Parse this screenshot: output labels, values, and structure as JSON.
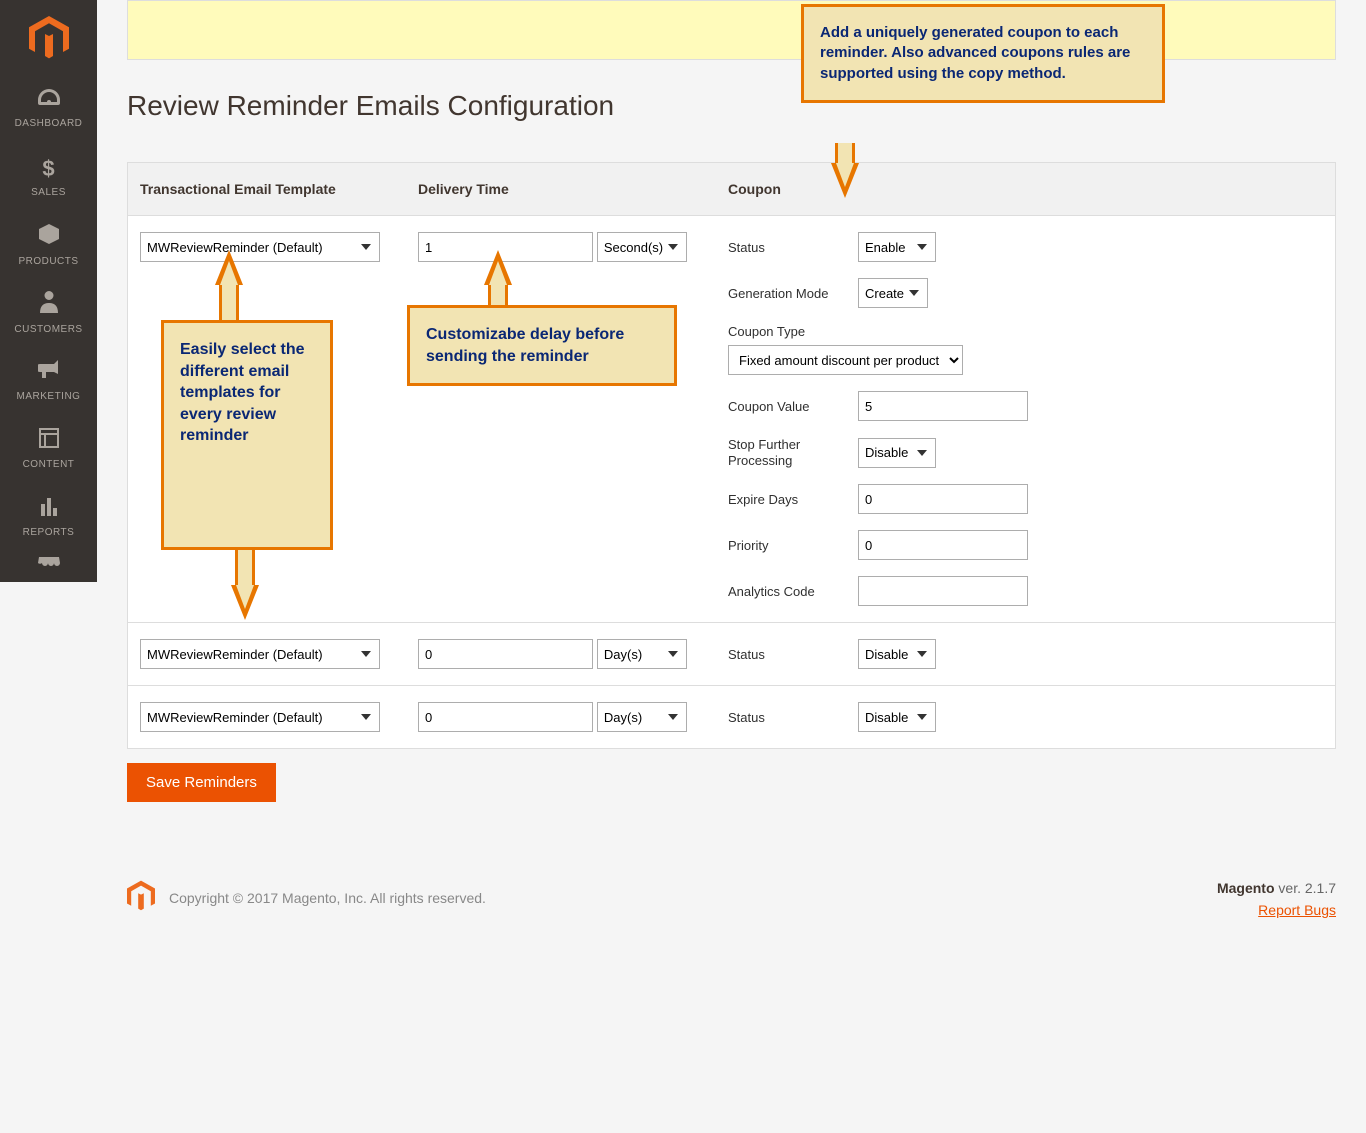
{
  "sidebar": {
    "items": [
      {
        "label": "DASHBOARD",
        "glyph": "◔"
      },
      {
        "label": "SALES",
        "glyph": "$"
      },
      {
        "label": "PRODUCTS",
        "glyph": "⬢"
      },
      {
        "label": "CUSTOMERS",
        "glyph": "👤"
      },
      {
        "label": "MARKETING",
        "glyph": "📣"
      },
      {
        "label": "CONTENT",
        "glyph": "▣"
      },
      {
        "label": "REPORTS",
        "glyph": "📊"
      }
    ]
  },
  "page": {
    "title": "Review Reminder Emails Configuration",
    "save_label": "Save Reminders"
  },
  "columns": {
    "template": "Transactional Email Template",
    "delivery": "Delivery Time",
    "coupon": "Coupon"
  },
  "rows": [
    {
      "template": "MWReviewReminder (Default)",
      "delivery_value": "1",
      "delivery_unit": "Second(s)",
      "coupon": {
        "status_label": "Status",
        "status_value": "Enable",
        "genmode_label": "Generation Mode",
        "genmode_value": "Create",
        "type_label": "Coupon Type",
        "type_value": "Fixed amount discount per product",
        "value_label": "Coupon Value",
        "value_value": "5",
        "stop_label": "Stop Further Processing",
        "stop_value": "Disable",
        "expire_label": "Expire Days",
        "expire_value": "0",
        "priority_label": "Priority",
        "priority_value": "0",
        "analytics_label": "Analytics Code",
        "analytics_value": ""
      }
    },
    {
      "template": "MWReviewReminder (Default)",
      "delivery_value": "0",
      "delivery_unit": "Day(s)",
      "coupon": {
        "status_label": "Status",
        "status_value": "Disable"
      }
    },
    {
      "template": "MWReviewReminder (Default)",
      "delivery_value": "0",
      "delivery_unit": "Day(s)",
      "coupon": {
        "status_label": "Status",
        "status_value": "Disable"
      }
    }
  ],
  "callouts": {
    "top": "Add a uniquely generated coupon to each reminder. Also advanced coupons rules are supported using the copy method.",
    "delivery": "Customizabe delay before sending the reminder",
    "template": "Easily select the different email templates for every review reminder"
  },
  "footer": {
    "copyright": "Copyright © 2017 Magento, Inc. All rights reserved.",
    "brand": "Magento",
    "version": " ver. 2.1.7",
    "report_link": "Report Bugs"
  }
}
